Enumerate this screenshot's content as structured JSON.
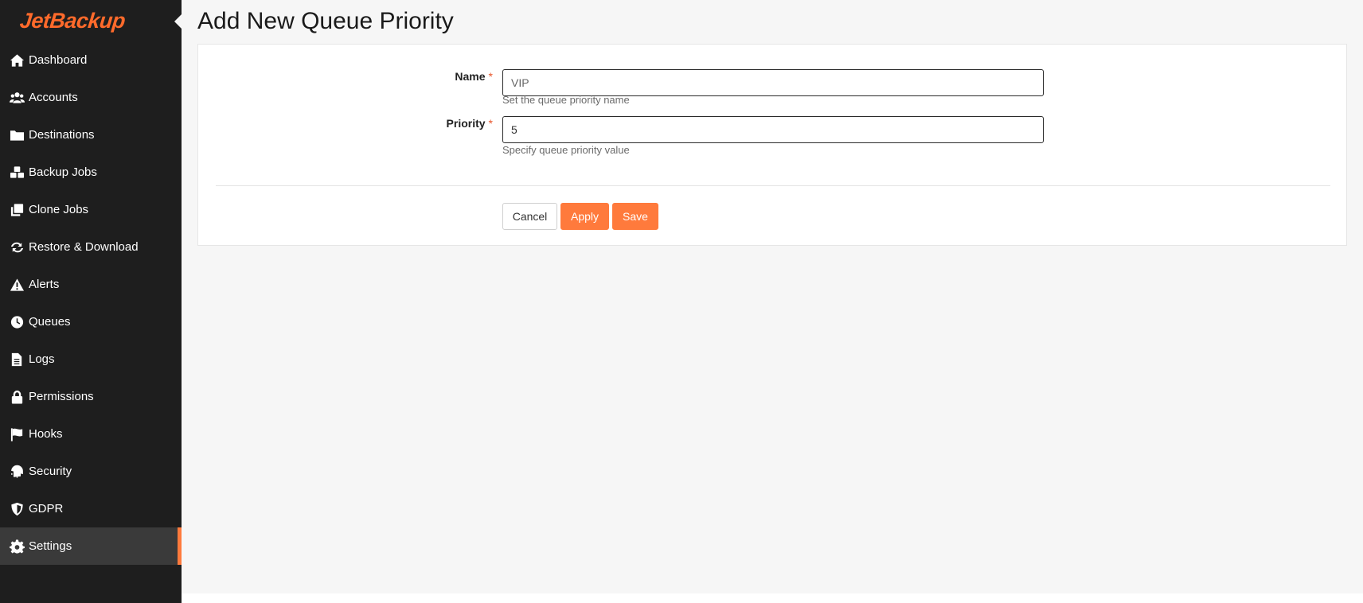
{
  "brand": {
    "logo_text": "JetBackup",
    "accent_color": "#ff7a3c"
  },
  "sidebar": {
    "items": [
      {
        "label": "Dashboard",
        "icon": "home-icon"
      },
      {
        "label": "Accounts",
        "icon": "users-icon"
      },
      {
        "label": "Destinations",
        "icon": "folder-icon"
      },
      {
        "label": "Backup Jobs",
        "icon": "cubes-icon"
      },
      {
        "label": "Clone Jobs",
        "icon": "clone-icon"
      },
      {
        "label": "Restore & Download",
        "icon": "sync-icon"
      },
      {
        "label": "Alerts",
        "icon": "warning-icon"
      },
      {
        "label": "Queues",
        "icon": "clock-icon"
      },
      {
        "label": "Logs",
        "icon": "file-icon"
      },
      {
        "label": "Permissions",
        "icon": "lock-icon"
      },
      {
        "label": "Hooks",
        "icon": "flag-icon"
      },
      {
        "label": "Security",
        "icon": "fingerprint-icon"
      },
      {
        "label": "GDPR",
        "icon": "shield-icon"
      },
      {
        "label": "Settings",
        "icon": "gear-icon",
        "active": true
      }
    ]
  },
  "page": {
    "title": "Add New Queue Priority"
  },
  "form": {
    "name": {
      "label": "Name",
      "required_mark": "*",
      "placeholder": "VIP",
      "value": "",
      "help": "Set the queue priority name"
    },
    "priority": {
      "label": "Priority",
      "required_mark": "*",
      "placeholder": "",
      "value": "5",
      "help": "Specify queue priority value"
    }
  },
  "buttons": {
    "cancel": "Cancel",
    "apply": "Apply",
    "save": "Save"
  }
}
